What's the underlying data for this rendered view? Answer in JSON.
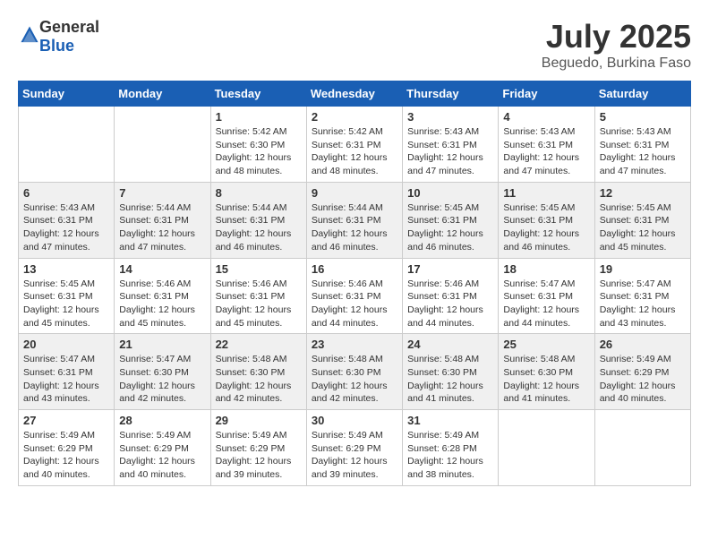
{
  "header": {
    "logo_general": "General",
    "logo_blue": "Blue",
    "month": "July 2025",
    "location": "Beguedo, Burkina Faso"
  },
  "days_of_week": [
    "Sunday",
    "Monday",
    "Tuesday",
    "Wednesday",
    "Thursday",
    "Friday",
    "Saturday"
  ],
  "weeks": [
    [
      {
        "day": "",
        "sunrise": "",
        "sunset": "",
        "daylight": ""
      },
      {
        "day": "",
        "sunrise": "",
        "sunset": "",
        "daylight": ""
      },
      {
        "day": "1",
        "sunrise": "Sunrise: 5:42 AM",
        "sunset": "Sunset: 6:30 PM",
        "daylight": "Daylight: 12 hours and 48 minutes."
      },
      {
        "day": "2",
        "sunrise": "Sunrise: 5:42 AM",
        "sunset": "Sunset: 6:31 PM",
        "daylight": "Daylight: 12 hours and 48 minutes."
      },
      {
        "day": "3",
        "sunrise": "Sunrise: 5:43 AM",
        "sunset": "Sunset: 6:31 PM",
        "daylight": "Daylight: 12 hours and 47 minutes."
      },
      {
        "day": "4",
        "sunrise": "Sunrise: 5:43 AM",
        "sunset": "Sunset: 6:31 PM",
        "daylight": "Daylight: 12 hours and 47 minutes."
      },
      {
        "day": "5",
        "sunrise": "Sunrise: 5:43 AM",
        "sunset": "Sunset: 6:31 PM",
        "daylight": "Daylight: 12 hours and 47 minutes."
      }
    ],
    [
      {
        "day": "6",
        "sunrise": "Sunrise: 5:43 AM",
        "sunset": "Sunset: 6:31 PM",
        "daylight": "Daylight: 12 hours and 47 minutes."
      },
      {
        "day": "7",
        "sunrise": "Sunrise: 5:44 AM",
        "sunset": "Sunset: 6:31 PM",
        "daylight": "Daylight: 12 hours and 47 minutes."
      },
      {
        "day": "8",
        "sunrise": "Sunrise: 5:44 AM",
        "sunset": "Sunset: 6:31 PM",
        "daylight": "Daylight: 12 hours and 46 minutes."
      },
      {
        "day": "9",
        "sunrise": "Sunrise: 5:44 AM",
        "sunset": "Sunset: 6:31 PM",
        "daylight": "Daylight: 12 hours and 46 minutes."
      },
      {
        "day": "10",
        "sunrise": "Sunrise: 5:45 AM",
        "sunset": "Sunset: 6:31 PM",
        "daylight": "Daylight: 12 hours and 46 minutes."
      },
      {
        "day": "11",
        "sunrise": "Sunrise: 5:45 AM",
        "sunset": "Sunset: 6:31 PM",
        "daylight": "Daylight: 12 hours and 46 minutes."
      },
      {
        "day": "12",
        "sunrise": "Sunrise: 5:45 AM",
        "sunset": "Sunset: 6:31 PM",
        "daylight": "Daylight: 12 hours and 45 minutes."
      }
    ],
    [
      {
        "day": "13",
        "sunrise": "Sunrise: 5:45 AM",
        "sunset": "Sunset: 6:31 PM",
        "daylight": "Daylight: 12 hours and 45 minutes."
      },
      {
        "day": "14",
        "sunrise": "Sunrise: 5:46 AM",
        "sunset": "Sunset: 6:31 PM",
        "daylight": "Daylight: 12 hours and 45 minutes."
      },
      {
        "day": "15",
        "sunrise": "Sunrise: 5:46 AM",
        "sunset": "Sunset: 6:31 PM",
        "daylight": "Daylight: 12 hours and 45 minutes."
      },
      {
        "day": "16",
        "sunrise": "Sunrise: 5:46 AM",
        "sunset": "Sunset: 6:31 PM",
        "daylight": "Daylight: 12 hours and 44 minutes."
      },
      {
        "day": "17",
        "sunrise": "Sunrise: 5:46 AM",
        "sunset": "Sunset: 6:31 PM",
        "daylight": "Daylight: 12 hours and 44 minutes."
      },
      {
        "day": "18",
        "sunrise": "Sunrise: 5:47 AM",
        "sunset": "Sunset: 6:31 PM",
        "daylight": "Daylight: 12 hours and 44 minutes."
      },
      {
        "day": "19",
        "sunrise": "Sunrise: 5:47 AM",
        "sunset": "Sunset: 6:31 PM",
        "daylight": "Daylight: 12 hours and 43 minutes."
      }
    ],
    [
      {
        "day": "20",
        "sunrise": "Sunrise: 5:47 AM",
        "sunset": "Sunset: 6:31 PM",
        "daylight": "Daylight: 12 hours and 43 minutes."
      },
      {
        "day": "21",
        "sunrise": "Sunrise: 5:47 AM",
        "sunset": "Sunset: 6:30 PM",
        "daylight": "Daylight: 12 hours and 42 minutes."
      },
      {
        "day": "22",
        "sunrise": "Sunrise: 5:48 AM",
        "sunset": "Sunset: 6:30 PM",
        "daylight": "Daylight: 12 hours and 42 minutes."
      },
      {
        "day": "23",
        "sunrise": "Sunrise: 5:48 AM",
        "sunset": "Sunset: 6:30 PM",
        "daylight": "Daylight: 12 hours and 42 minutes."
      },
      {
        "day": "24",
        "sunrise": "Sunrise: 5:48 AM",
        "sunset": "Sunset: 6:30 PM",
        "daylight": "Daylight: 12 hours and 41 minutes."
      },
      {
        "day": "25",
        "sunrise": "Sunrise: 5:48 AM",
        "sunset": "Sunset: 6:30 PM",
        "daylight": "Daylight: 12 hours and 41 minutes."
      },
      {
        "day": "26",
        "sunrise": "Sunrise: 5:49 AM",
        "sunset": "Sunset: 6:29 PM",
        "daylight": "Daylight: 12 hours and 40 minutes."
      }
    ],
    [
      {
        "day": "27",
        "sunrise": "Sunrise: 5:49 AM",
        "sunset": "Sunset: 6:29 PM",
        "daylight": "Daylight: 12 hours and 40 minutes."
      },
      {
        "day": "28",
        "sunrise": "Sunrise: 5:49 AM",
        "sunset": "Sunset: 6:29 PM",
        "daylight": "Daylight: 12 hours and 40 minutes."
      },
      {
        "day": "29",
        "sunrise": "Sunrise: 5:49 AM",
        "sunset": "Sunset: 6:29 PM",
        "daylight": "Daylight: 12 hours and 39 minutes."
      },
      {
        "day": "30",
        "sunrise": "Sunrise: 5:49 AM",
        "sunset": "Sunset: 6:29 PM",
        "daylight": "Daylight: 12 hours and 39 minutes."
      },
      {
        "day": "31",
        "sunrise": "Sunrise: 5:49 AM",
        "sunset": "Sunset: 6:28 PM",
        "daylight": "Daylight: 12 hours and 38 minutes."
      },
      {
        "day": "",
        "sunrise": "",
        "sunset": "",
        "daylight": ""
      },
      {
        "day": "",
        "sunrise": "",
        "sunset": "",
        "daylight": ""
      }
    ]
  ]
}
